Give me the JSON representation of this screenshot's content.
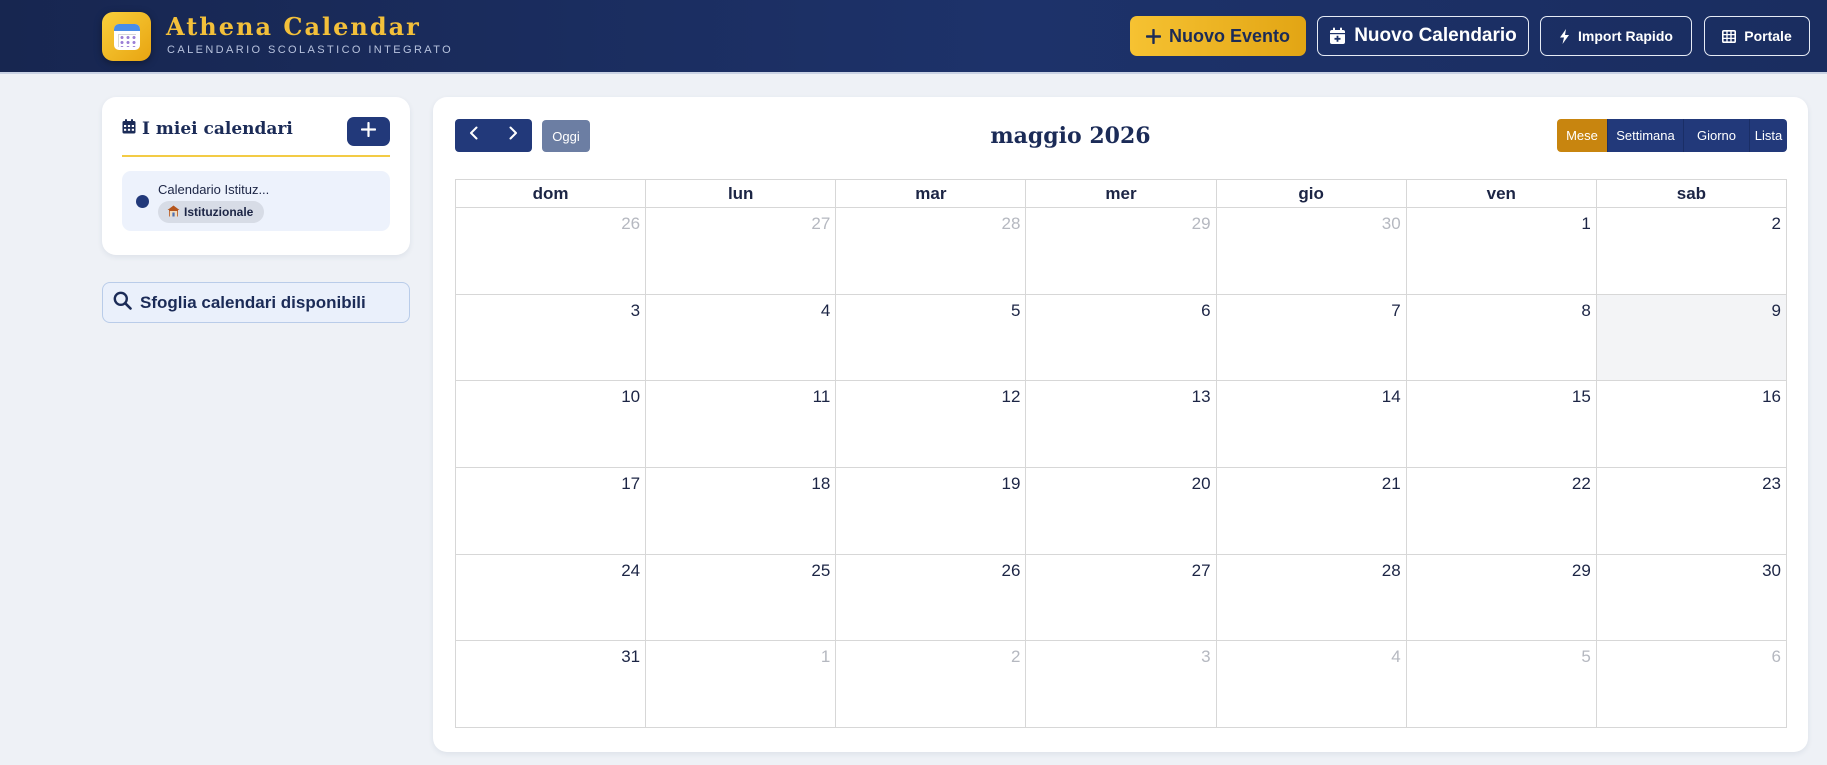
{
  "app": {
    "title": "Athena Calendar",
    "subtitle": "CALENDARIO SCOLASTICO INTEGRATO"
  },
  "header": {
    "buttons": {
      "new_event": "Nuovo Evento",
      "new_calendar": "Nuovo Calendario",
      "quick_import": "Import Rapido",
      "portal": "Portale"
    }
  },
  "sidebar": {
    "title": "I miei calendari",
    "calendars": [
      {
        "name": "Calendario Istituz...",
        "badge": "Istituzionale",
        "color": "#22397a"
      }
    ],
    "browse_label": "Sfoglia calendari disponibili"
  },
  "calendar": {
    "month_title": "maggio 2026",
    "today_label": "Oggi",
    "views": [
      "Mese",
      "Settimana",
      "Giorno",
      "Lista"
    ],
    "active_view": "Mese",
    "weekdays": [
      "dom",
      "lun",
      "mar",
      "mer",
      "gio",
      "ven",
      "sab"
    ],
    "weeks": [
      [
        {
          "d": "26",
          "o": true
        },
        {
          "d": "27",
          "o": true
        },
        {
          "d": "28",
          "o": true
        },
        {
          "d": "29",
          "o": true
        },
        {
          "d": "30",
          "o": true
        },
        {
          "d": "1"
        },
        {
          "d": "2"
        }
      ],
      [
        {
          "d": "3"
        },
        {
          "d": "4"
        },
        {
          "d": "5"
        },
        {
          "d": "6"
        },
        {
          "d": "7"
        },
        {
          "d": "8"
        },
        {
          "d": "9",
          "today": true
        }
      ],
      [
        {
          "d": "10"
        },
        {
          "d": "11"
        },
        {
          "d": "12"
        },
        {
          "d": "13"
        },
        {
          "d": "14"
        },
        {
          "d": "15"
        },
        {
          "d": "16"
        }
      ],
      [
        {
          "d": "17"
        },
        {
          "d": "18"
        },
        {
          "d": "19"
        },
        {
          "d": "20"
        },
        {
          "d": "21"
        },
        {
          "d": "22"
        },
        {
          "d": "23"
        }
      ],
      [
        {
          "d": "24"
        },
        {
          "d": "25"
        },
        {
          "d": "26"
        },
        {
          "d": "27"
        },
        {
          "d": "28"
        },
        {
          "d": "29"
        },
        {
          "d": "30"
        }
      ],
      [
        {
          "d": "31"
        },
        {
          "d": "1",
          "o": true
        },
        {
          "d": "2",
          "o": true
        },
        {
          "d": "3",
          "o": true
        },
        {
          "d": "4",
          "o": true
        },
        {
          "d": "5",
          "o": true
        },
        {
          "d": "6",
          "o": true
        }
      ]
    ]
  },
  "colors": {
    "header_bg": "#1b2d62",
    "accent_gold": "#f3c03a",
    "primary_navy": "#22397a",
    "active_view": "#c8850f",
    "today_bg": "#f3f4f6"
  }
}
